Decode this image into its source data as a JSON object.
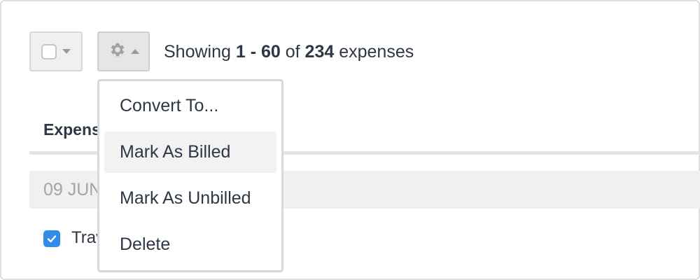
{
  "toolbar": {
    "select_all_checked": false,
    "gear_icon": "gear-icon"
  },
  "summary": {
    "prefix": "Showing ",
    "range": "1 - 60",
    "of": " of ",
    "total": "234",
    "suffix": " expenses"
  },
  "table": {
    "column_header": "Expense",
    "date_group": "09 JUN",
    "row_text": "Travel",
    "row_checked": true
  },
  "menu": {
    "items": [
      {
        "label": "Convert To..."
      },
      {
        "label": "Mark As Billed"
      },
      {
        "label": "Mark As Unbilled"
      },
      {
        "label": "Delete"
      }
    ],
    "hovered_index": 1
  },
  "colors": {
    "accent": "#2f8ce8",
    "text": "#2e3746",
    "muted": "#a4a4a4"
  }
}
